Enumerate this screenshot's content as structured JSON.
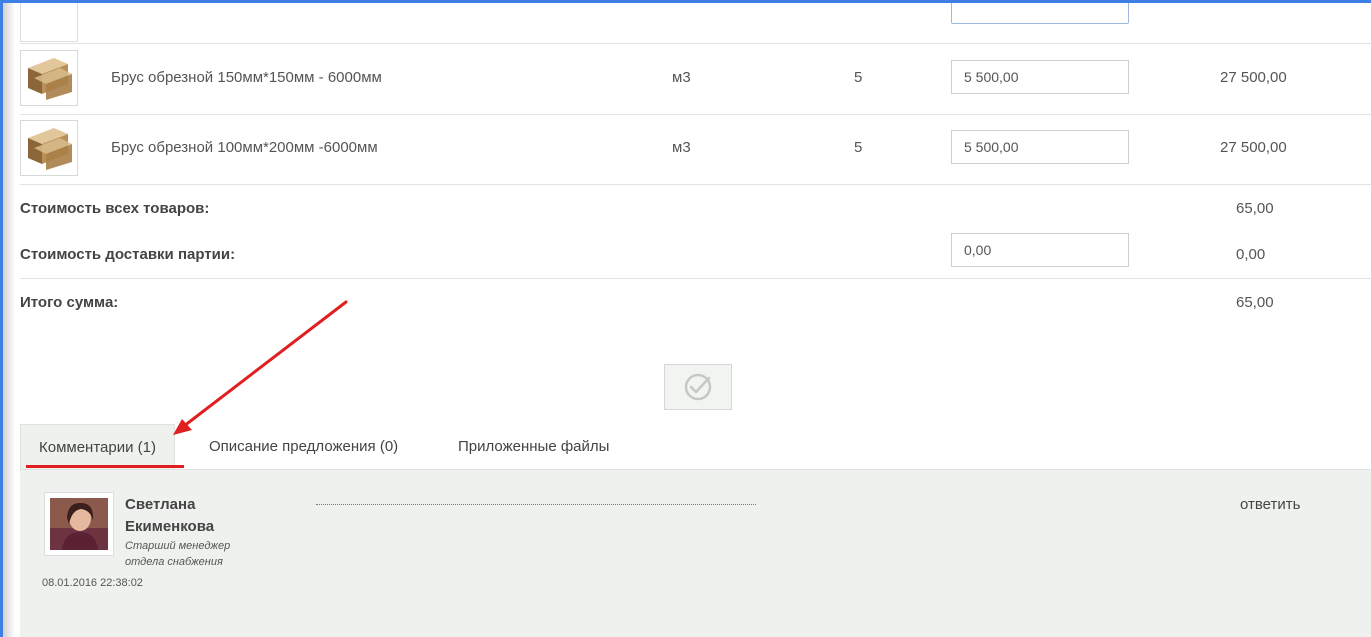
{
  "products": [
    {
      "name": "Брус обрезной 150мм*150мм - 6000мм",
      "unit": "м3",
      "quantity": "5",
      "price": "5 500,00",
      "total": "27 500,00"
    },
    {
      "name": "Брус обрезной 100мм*200мм -6000мм",
      "unit": "м3",
      "quantity": "5",
      "price": "5 500,00",
      "total": "27 500,00"
    }
  ],
  "summary": {
    "goods_label": "Стоимость всех товаров:",
    "goods_value": "65,00",
    "delivery_label": "Стоимость доставки партии:",
    "delivery_input": "0,00",
    "delivery_value": "0,00",
    "total_label": "Итого сумма:",
    "total_value": "65,00"
  },
  "tabs": [
    {
      "label": "Комментарии (1)",
      "active": true
    },
    {
      "label": "Описание предложения (0)",
      "active": false
    },
    {
      "label": "Приложенные файлы",
      "active": false
    }
  ],
  "comment": {
    "author_first": "Светлана",
    "author_last": "Екименкова",
    "role": "Старший менеджер отдела снабжения",
    "date": "08.01.2016 22:38:02",
    "reply_label": "ответить"
  },
  "colors": {
    "frame_border": "#3e7fe6",
    "annotation_red": "#e02020",
    "panel_bg": "#eef1ee"
  },
  "icons": {
    "confirm": "check-circle-icon",
    "product_thumbnail": "timber-beam-icon"
  }
}
